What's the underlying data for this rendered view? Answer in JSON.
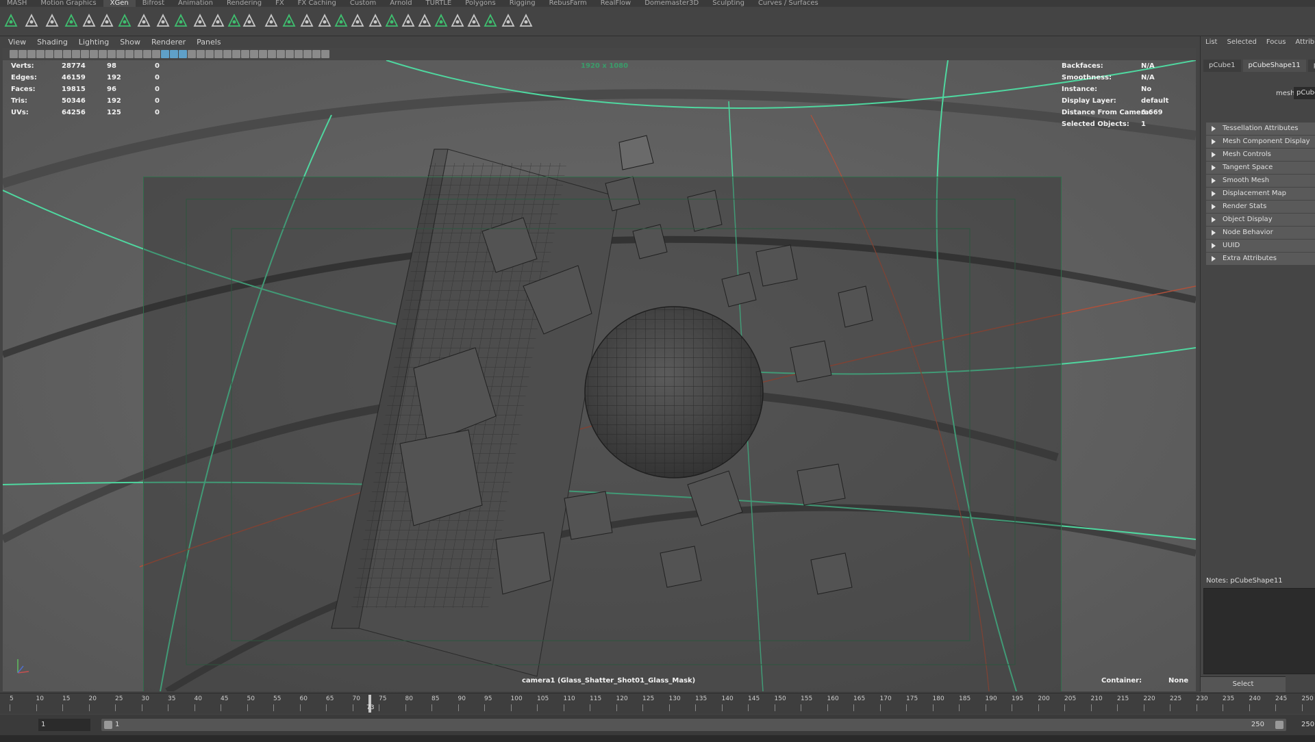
{
  "shelf_tabs": [
    "MASH",
    "Motion Graphics",
    "XGen",
    "Bifrost",
    "Animation",
    "Rendering",
    "FX",
    "FX Caching",
    "Custom",
    "Arnold",
    "TURTLE",
    "Polygons",
    "Rigging",
    "RebusFarm",
    "RealFlow",
    "Domemaster3D",
    "Sculpting",
    "Curves / Surfaces"
  ],
  "active_shelf": "XGen",
  "viewport_menu": [
    "View",
    "Shading",
    "Lighting",
    "Show",
    "Renderer",
    "Panels"
  ],
  "hud_left": [
    {
      "label": "Verts:",
      "v1": "28774",
      "v2": "98",
      "v3": "0"
    },
    {
      "label": "Edges:",
      "v1": "46159",
      "v2": "192",
      "v3": "0"
    },
    {
      "label": "Faces:",
      "v1": "19815",
      "v2": "96",
      "v3": "0"
    },
    {
      "label": "Tris:",
      "v1": "50346",
      "v2": "192",
      "v3": "0"
    },
    {
      "label": "UVs:",
      "v1": "64256",
      "v2": "125",
      "v3": "0"
    }
  ],
  "hud_right": [
    {
      "label": "Backfaces:",
      "value": "N/A"
    },
    {
      "label": "Smoothness:",
      "value": "N/A"
    },
    {
      "label": "Instance:",
      "value": "No"
    },
    {
      "label": "Display Layer:",
      "value": "default"
    },
    {
      "label": "Distance From Camera:",
      "value": "6.669"
    },
    {
      "label": "Selected Objects:",
      "value": "1"
    }
  ],
  "resolution": "1920 x 1080",
  "camera_label": "camera1 (Glass_Shatter_Shot01_Glass_Mask)",
  "container_label": "Container:",
  "container_value": "None",
  "attr_menu": [
    "List",
    "Selected",
    "Focus",
    "Attributes"
  ],
  "attr_tabs": [
    "pCube1",
    "pCubeShape11",
    "pc"
  ],
  "attr_active_tab": "pCubeShape11",
  "mesh_label": "mesh:",
  "mesh_value": "pCube",
  "sections": [
    "Tessellation Attributes",
    "Mesh Component Display",
    "Mesh Controls",
    "Tangent Space",
    "Smooth Mesh",
    "Displacement Map",
    "Render Stats",
    "Object Display",
    "Node Behavior",
    "UUID",
    "Extra Attributes"
  ],
  "notes_label": "Notes:  pCubeShape11",
  "select_button": "Select",
  "timeline_ticks": [
    "5",
    "10",
    "15",
    "20",
    "25",
    "30",
    "35",
    "40",
    "45",
    "50",
    "55",
    "60",
    "65",
    "70",
    "75",
    "80",
    "85",
    "90",
    "95",
    "100",
    "105",
    "110",
    "115",
    "120",
    "125",
    "130",
    "135",
    "140",
    "145",
    "150",
    "155",
    "160",
    "165",
    "170",
    "175",
    "180",
    "185",
    "190",
    "195",
    "200",
    "205",
    "210",
    "215",
    "220",
    "225",
    "230",
    "235",
    "240",
    "245",
    "250"
  ],
  "current_frame": "73",
  "range_start": "1",
  "range_inner_start": "1",
  "range_inner_end": "250",
  "range_end": "250",
  "colors": {
    "accent_green": "#4fd8a0",
    "curve_red": "#b0503a",
    "gate_border": "#2f6e4a"
  }
}
